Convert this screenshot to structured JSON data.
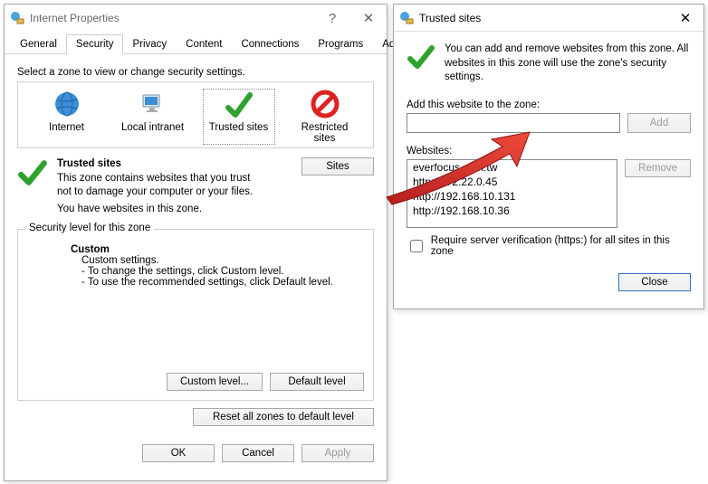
{
  "parent": {
    "title": "Internet Properties",
    "tabs": [
      "General",
      "Security",
      "Privacy",
      "Content",
      "Connections",
      "Programs",
      "Advanced"
    ],
    "activeTab": 1,
    "prompt": "Select a zone to view or change security settings.",
    "zones": [
      "Internet",
      "Local intranet",
      "Trusted sites",
      "Restricted sites"
    ],
    "zone_selected": 2,
    "trusted": {
      "heading": "Trusted sites",
      "line1": "This zone contains websites that you trust not to damage your computer or your files.",
      "line2": "You have websites in this zone.",
      "sites_btn": "Sites"
    },
    "level_group": "Security level for this zone",
    "custom": {
      "title": "Custom",
      "sub": "Custom settings.",
      "l1": "- To change the settings, click Custom level.",
      "l2": "- To use the recommended settings, click Default level."
    },
    "btn_custom": "Custom level...",
    "btn_default": "Default level",
    "btn_reset": "Reset all zones to default level",
    "ok": "OK",
    "cancel": "Cancel",
    "apply": "Apply"
  },
  "dialog": {
    "title": "Trusted sites",
    "info": "You can add and remove websites from this zone. All websites in this zone will use the zone's security settings.",
    "add_label": "Add this website to the zone:",
    "add_btn": "Add",
    "websites_label": "Websites:",
    "sites": [
      "everfocus.com.tw",
      "http://172.22.0.45",
      "http://192.168.10.131",
      "http://192.168.10.36"
    ],
    "remove_btn": "Remove",
    "require_label": "Require server verification (https:) for all sites in this zone",
    "close": "Close"
  }
}
